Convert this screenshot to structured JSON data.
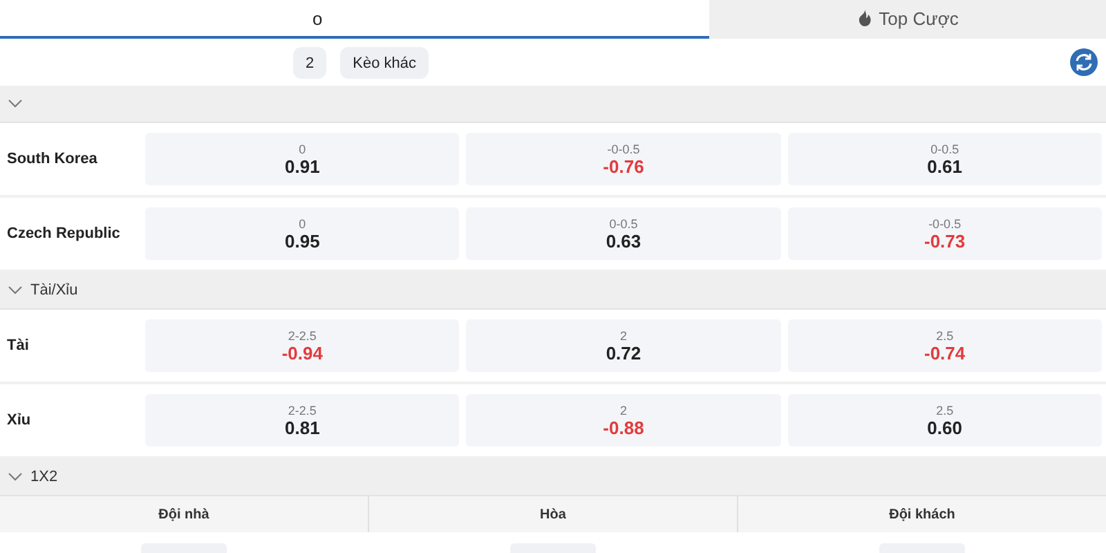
{
  "tabs": [
    {
      "label": "o",
      "selected": true
    },
    {
      "label": "Top Cược",
      "selected": false
    }
  ],
  "filters": [
    {
      "label": "2",
      "selected": false
    },
    {
      "label": "Kèo khác",
      "selected": false
    }
  ],
  "sections": [
    {
      "expanded": true,
      "rows": [
        {
          "name": "South Korea",
          "cells": [
            {
              "line": "0",
              "odds": "0.91",
              "negative": false
            },
            {
              "line": "-0-0.5",
              "odds": "-0.76",
              "negative": true
            },
            {
              "line": "0-0.5",
              "odds": "0.61",
              "negative": false
            }
          ]
        },
        {
          "name": "Czech Republic",
          "cells": [
            {
              "line": "0",
              "odds": "0.95",
              "negative": false
            },
            {
              "line": "0-0.5",
              "odds": "0.63",
              "negative": false
            },
            {
              "line": "-0-0.5",
              "odds": "-0.73",
              "negative": true
            }
          ]
        }
      ]
    },
    {
      "title": "Tài/Xỉu",
      "expanded": true,
      "rows": [
        {
          "name": "Tài",
          "cells": [
            {
              "line": "2-2.5",
              "odds": "-0.94",
              "negative": true
            },
            {
              "line": "2",
              "odds": "0.72",
              "negative": false
            },
            {
              "line": "2.5",
              "odds": "-0.74",
              "negative": true
            }
          ]
        },
        {
          "name": "Xỉu",
          "cells": [
            {
              "line": "2-2.5",
              "odds": "0.81",
              "negative": false
            },
            {
              "line": "2",
              "odds": "-0.88",
              "negative": true
            },
            {
              "line": "2.5",
              "odds": "0.60",
              "negative": false
            }
          ]
        }
      ]
    },
    {
      "title": "1X2",
      "expanded": true,
      "columns": [
        "Đội nhà",
        "Hòa",
        "Đội khách"
      ]
    }
  ]
}
